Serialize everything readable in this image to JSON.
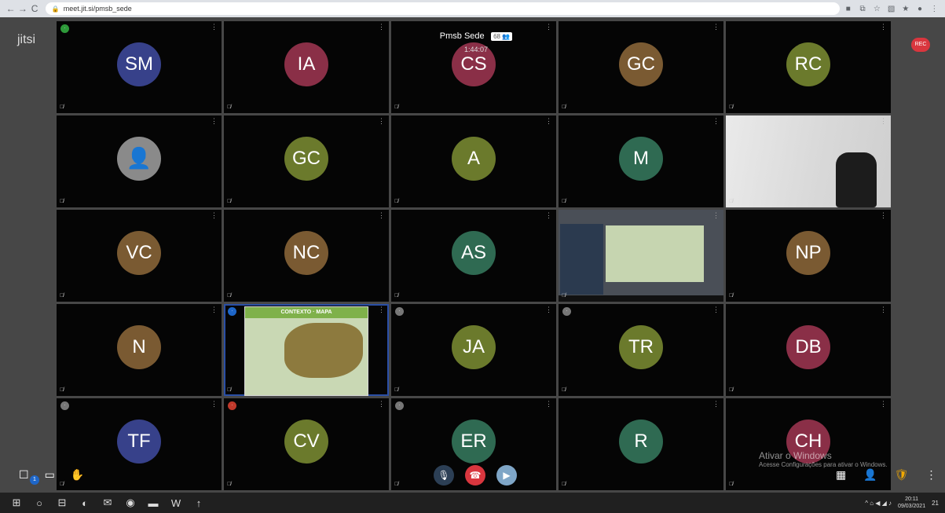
{
  "browser": {
    "back": "←",
    "forward": "→",
    "reload": "C",
    "lock": "🔒",
    "url": "meet.jit.si/pmsb_sede",
    "extensions": [
      "■",
      "⧉",
      "☆",
      "▧",
      "★",
      "●",
      "⋮"
    ]
  },
  "app": {
    "logo": "jitsi"
  },
  "conference": {
    "name": "Pmsb Sede",
    "participants": "68",
    "participants_icon": "👥",
    "timer": "1:44:07",
    "recording": "REC"
  },
  "tiles": [
    {
      "initials": "SM",
      "color": "#37418a",
      "conn": "green"
    },
    {
      "initials": "IA",
      "color": "#8a2f47"
    },
    {
      "initials": "CS",
      "color": "#8a2f47"
    },
    {
      "initials": "GC",
      "color": "#7a5a32"
    },
    {
      "initials": "RC",
      "color": "#6b7a2c"
    },
    {
      "initials": "",
      "color": "",
      "generic": true
    },
    {
      "initials": "GC",
      "color": "#6b7a2c"
    },
    {
      "initials": "A",
      "color": "#6b7a2c"
    },
    {
      "initials": "M",
      "color": "#2f6a52"
    },
    {
      "initials": "",
      "color": "",
      "camera": true
    },
    {
      "initials": "VC",
      "color": "#7a5a32"
    },
    {
      "initials": "NC",
      "color": "#7a5a32"
    },
    {
      "initials": "AS",
      "color": "#2f6a52"
    },
    {
      "initials": "",
      "color": "",
      "screen": true
    },
    {
      "initials": "NP",
      "color": "#7a5a32"
    },
    {
      "initials": "N",
      "color": "#7a5a32"
    },
    {
      "initials": "",
      "color": "",
      "share": true,
      "conn": "blue"
    },
    {
      "initials": "JA",
      "color": "#6b7a2c",
      "conn": "gray"
    },
    {
      "initials": "TR",
      "color": "#6b7a2c",
      "conn": "gray"
    },
    {
      "initials": "DB",
      "color": "#8a2f47"
    },
    {
      "initials": "TF",
      "color": "#37418a",
      "conn": "gray"
    },
    {
      "initials": "CV",
      "color": "#6b7a2c",
      "conn": "red"
    },
    {
      "initials": "ER",
      "color": "#2f6a52",
      "conn": "gray"
    },
    {
      "initials": "R",
      "color": "#2f6a52"
    },
    {
      "initials": "CH",
      "color": "#8a2f47"
    }
  ],
  "share": {
    "title": "CONTEXTO · MAPA"
  },
  "toolbar": {
    "chat": "☐",
    "chat_badge": "1",
    "screenshare": "▭",
    "raise_hand": "✋",
    "mic": "🎙",
    "hangup": "☎",
    "camera": "▶",
    "tile_view": "▦",
    "participants": "👤",
    "security": "🛡",
    "more": "⋮"
  },
  "watermark": {
    "line1": "Ativar o Windows",
    "line2": "Acesse Configurações para ativar o Windows."
  },
  "taskbar": {
    "apps": [
      "⊞",
      "○",
      "⊟",
      "◐",
      "✉",
      "◉",
      "▬",
      "W",
      "↑"
    ],
    "tray": "^ ⌂ ◀ ◢ ♪",
    "time": "20:11",
    "date": "09/03/2021",
    "notif": "21"
  }
}
